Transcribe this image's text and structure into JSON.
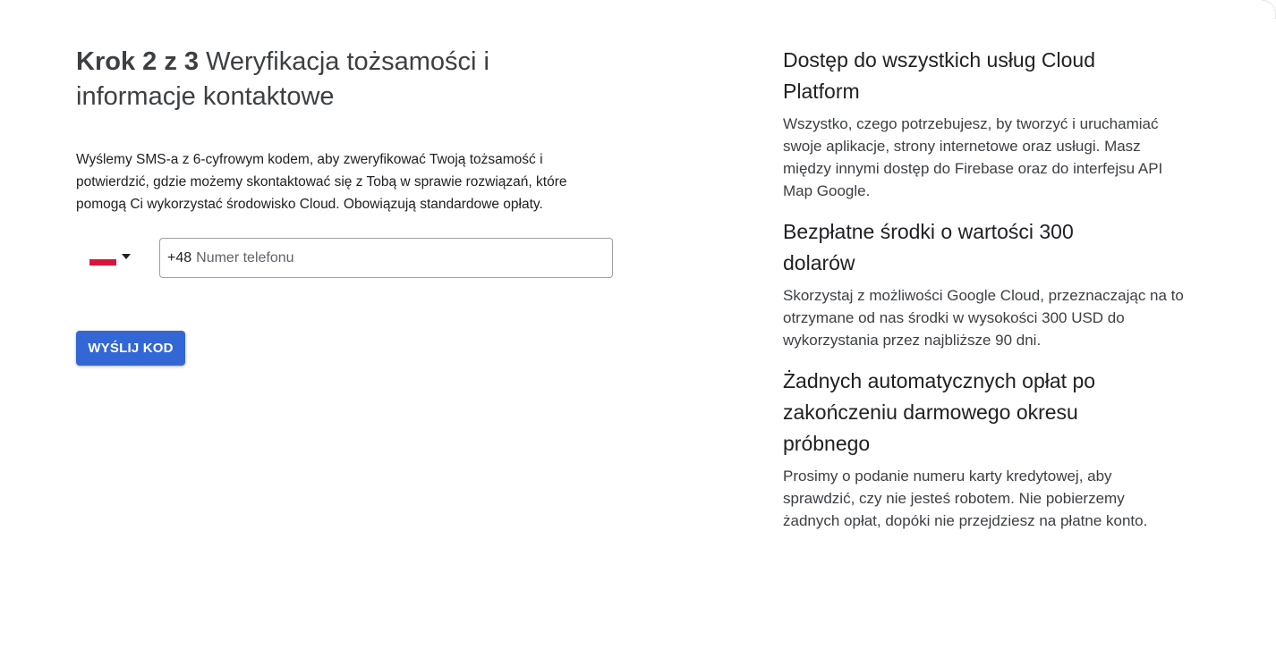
{
  "step": {
    "label": "Krok 2 z 3",
    "title": "Weryfikacja tożsamości i informacje kontaktowe",
    "description": "Wyślemy SMS-a z 6-cyfrowym kodem, aby zweryfikować Twoją tożsamość i potwierdzić, gdzie możemy skontaktować się z Tobą w sprawie rozwiązań, które pomogą Ci wykorzystać środowisko Cloud. Obowiązują standardowe opłaty."
  },
  "phone": {
    "country_flag_icon": "poland-flag-icon",
    "dropdown_icon": "caret-down-icon",
    "prefix": "+48",
    "value": "",
    "placeholder": "Numer telefonu"
  },
  "actions": {
    "send_code_label": "WYŚLIJ KOD"
  },
  "benefits": [
    {
      "title": "Dostęp do wszystkich usług Cloud Platform",
      "text": "Wszystko, czego potrzebujesz, by tworzyć i uruchamiać swoje aplikacje, strony internetowe oraz usługi. Masz między innymi dostęp do Firebase oraz do interfejsu API Map Google."
    },
    {
      "title": "Bezpłatne środki o wartości 300 dolarów",
      "text": "Skorzystaj z możliwości Google Cloud, przeznaczając na to otrzymane od nas środki w wysokości 300 USD do wykorzystania przez najbliższe 90 dni."
    },
    {
      "title": "Żadnych automatycznych opłat po zakończeniu darmowego okresu próbnego",
      "text": "Prosimy o podanie numeru karty kredytowej, aby sprawdzić, czy nie jesteś robotem. Nie pobierzemy żadnych opłat, dopóki nie przejdziesz na płatne konto."
    }
  ],
  "colors": {
    "primary_button": "#3367d6",
    "flag_red": "#dc143c",
    "text": "#202124"
  }
}
